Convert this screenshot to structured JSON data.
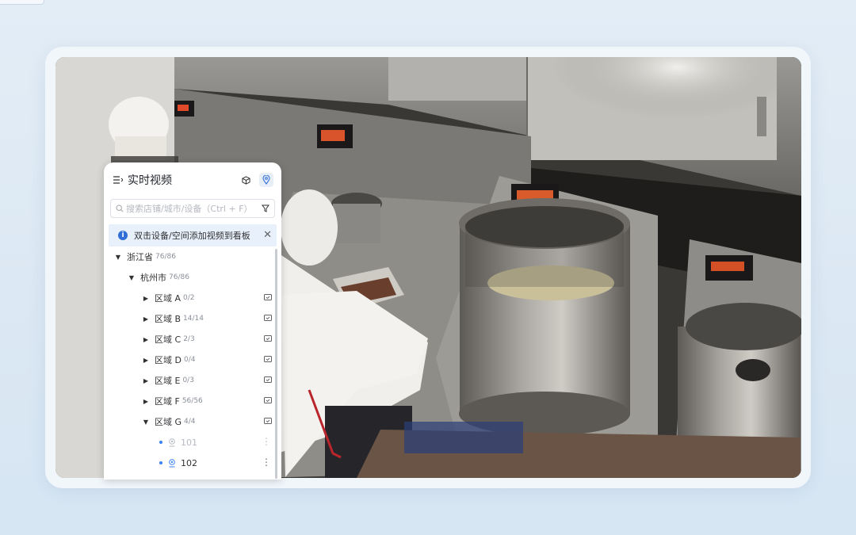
{
  "panel": {
    "title": "实时视频",
    "search_placeholder": "搜索店铺/城市/设备（Ctrl + F）",
    "notice": "双击设备/空间添加视频到看板",
    "tree": {
      "province": {
        "label": "浙江省",
        "count": "76/86"
      },
      "city": {
        "label": "杭州市",
        "count": "76/86"
      },
      "regions": [
        {
          "label": "区域 A",
          "count": "0/2"
        },
        {
          "label": "区域 B",
          "count": "14/14"
        },
        {
          "label": "区域 C",
          "count": "2/3"
        },
        {
          "label": "区域 D",
          "count": "0/4"
        },
        {
          "label": "区域 E",
          "count": "0/3"
        },
        {
          "label": "区域 F",
          "count": "56/56"
        },
        {
          "label": "区域 G",
          "count": "4/4"
        }
      ],
      "devices": [
        {
          "label": "101",
          "online": false
        },
        {
          "label": "102",
          "online": true
        }
      ]
    }
  },
  "icons": {
    "menu": "menu-list-icon",
    "cube": "cube-icon",
    "location": "location-pin-icon",
    "search": "search-icon",
    "filter": "filter-icon",
    "info": "info-icon",
    "close": "close-icon",
    "monitor": "monitor-icon",
    "camera": "camera-icon",
    "more": "more-vertical-icon"
  },
  "colors": {
    "accent": "#2f6fd6",
    "notice_bg": "#e8f1fb",
    "frame_bg": "#f1f6fb"
  }
}
